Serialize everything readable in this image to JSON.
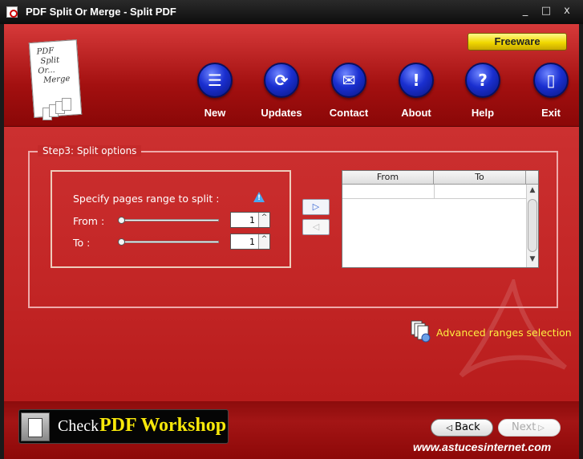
{
  "window": {
    "title": "PDF Split Or Merge - Split PDF",
    "minimize": "_",
    "maximize": "□",
    "close": "x"
  },
  "logo": {
    "lines": [
      "PDF",
      "Split",
      "Or...",
      "Merge"
    ]
  },
  "badge": "Freeware",
  "toolbar": [
    {
      "name": "new",
      "label": "New",
      "icon": "document-icon",
      "glyph": "☰"
    },
    {
      "name": "updates",
      "label": "Updates",
      "icon": "refresh-icon",
      "glyph": "⟳"
    },
    {
      "name": "contact",
      "label": "Contact",
      "icon": "envelope-icon",
      "glyph": "✉"
    },
    {
      "name": "about",
      "label": "About",
      "icon": "exclamation-icon",
      "glyph": "!"
    },
    {
      "name": "help",
      "label": "Help",
      "icon": "question-icon",
      "glyph": "?"
    },
    {
      "name": "exit",
      "label": "Exit",
      "icon": "door-icon",
      "glyph": "▯"
    }
  ],
  "step": {
    "title": "Step3: Split options",
    "range_title": "Specify pages range to split :",
    "from_label": "From :",
    "to_label": "To    :",
    "from_value": "1",
    "to_value": "1",
    "add_glyph": "▷",
    "remove_glyph": "◁",
    "table": {
      "columns": [
        "From",
        "To"
      ],
      "rows": []
    },
    "advanced_label": "Advanced ranges selection"
  },
  "footer": {
    "check_text": "Check",
    "check_brand": "PDF Workshop",
    "back_label": "Back",
    "next_label": "Next",
    "back_glyph": "◁",
    "next_glyph": "▷",
    "site": "www.astucesinternet.com"
  },
  "colors": {
    "accent_red": "#c42a2a",
    "nav_blue": "#1a2fd0",
    "link_yellow": "#ffef40",
    "badge_yellow": "#f0d800"
  }
}
